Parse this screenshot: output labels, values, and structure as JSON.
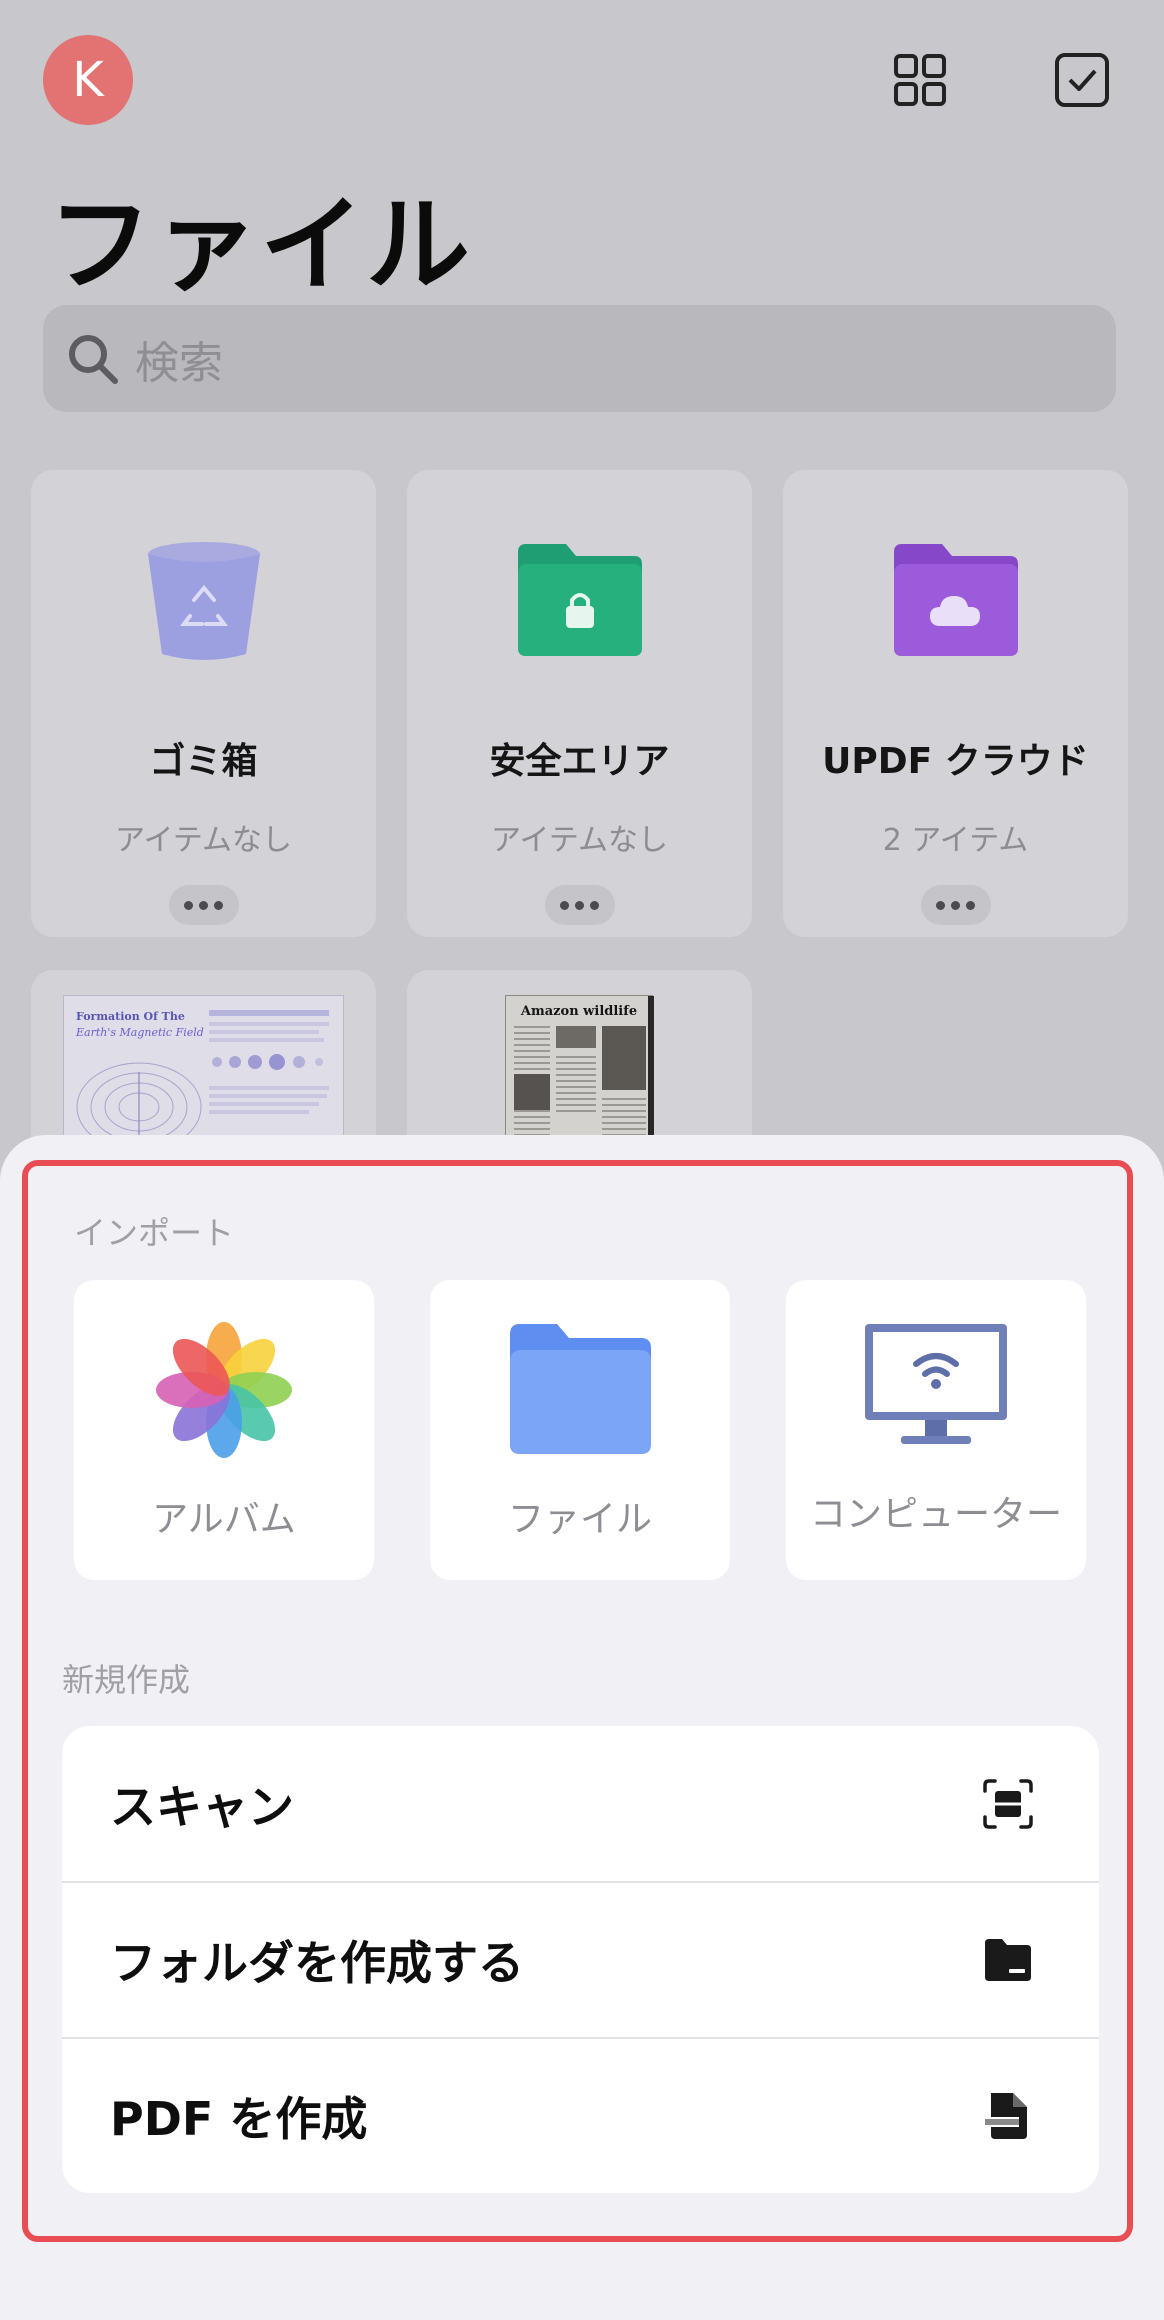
{
  "header": {
    "avatar_initial": "K",
    "title": "ファイル",
    "icons": [
      "grid-view-icon",
      "select-checkbox-icon"
    ]
  },
  "search": {
    "placeholder": "検索"
  },
  "folders": [
    {
      "name": "ゴミ箱",
      "subtitle": "アイテムなし",
      "icon": "trash-bin-icon"
    },
    {
      "name": "安全エリア",
      "subtitle": "アイテムなし",
      "icon": "secure-folder-icon"
    },
    {
      "name": "UPDF クラウド",
      "subtitle": "2 アイテム",
      "icon": "cloud-folder-icon"
    }
  ],
  "documents": [
    {
      "title_lines": [
        "Formation Of The",
        "Earth's Magnetic Field"
      ]
    },
    {
      "title": "Amazon wildlife"
    }
  ],
  "sheet": {
    "import_label": "インポート",
    "import_items": [
      {
        "label": "アルバム",
        "icon": "photos-icon"
      },
      {
        "label": "ファイル",
        "icon": "files-folder-icon"
      },
      {
        "label": "コンピューター",
        "icon": "computer-wifi-icon"
      }
    ],
    "create_label": "新規作成",
    "create_items": [
      {
        "label": "スキャン",
        "icon": "scan-icon"
      },
      {
        "label": "フォルダを作成する",
        "icon": "folder-icon"
      },
      {
        "label": "PDF を作成",
        "icon": "document-icon"
      }
    ]
  },
  "colors": {
    "highlight_border": "#e84d54",
    "avatar": "#e37272",
    "secure_folder": "#1faa7a",
    "cloud_folder": "#9656d6",
    "files_folder": "#6e9bf5"
  }
}
